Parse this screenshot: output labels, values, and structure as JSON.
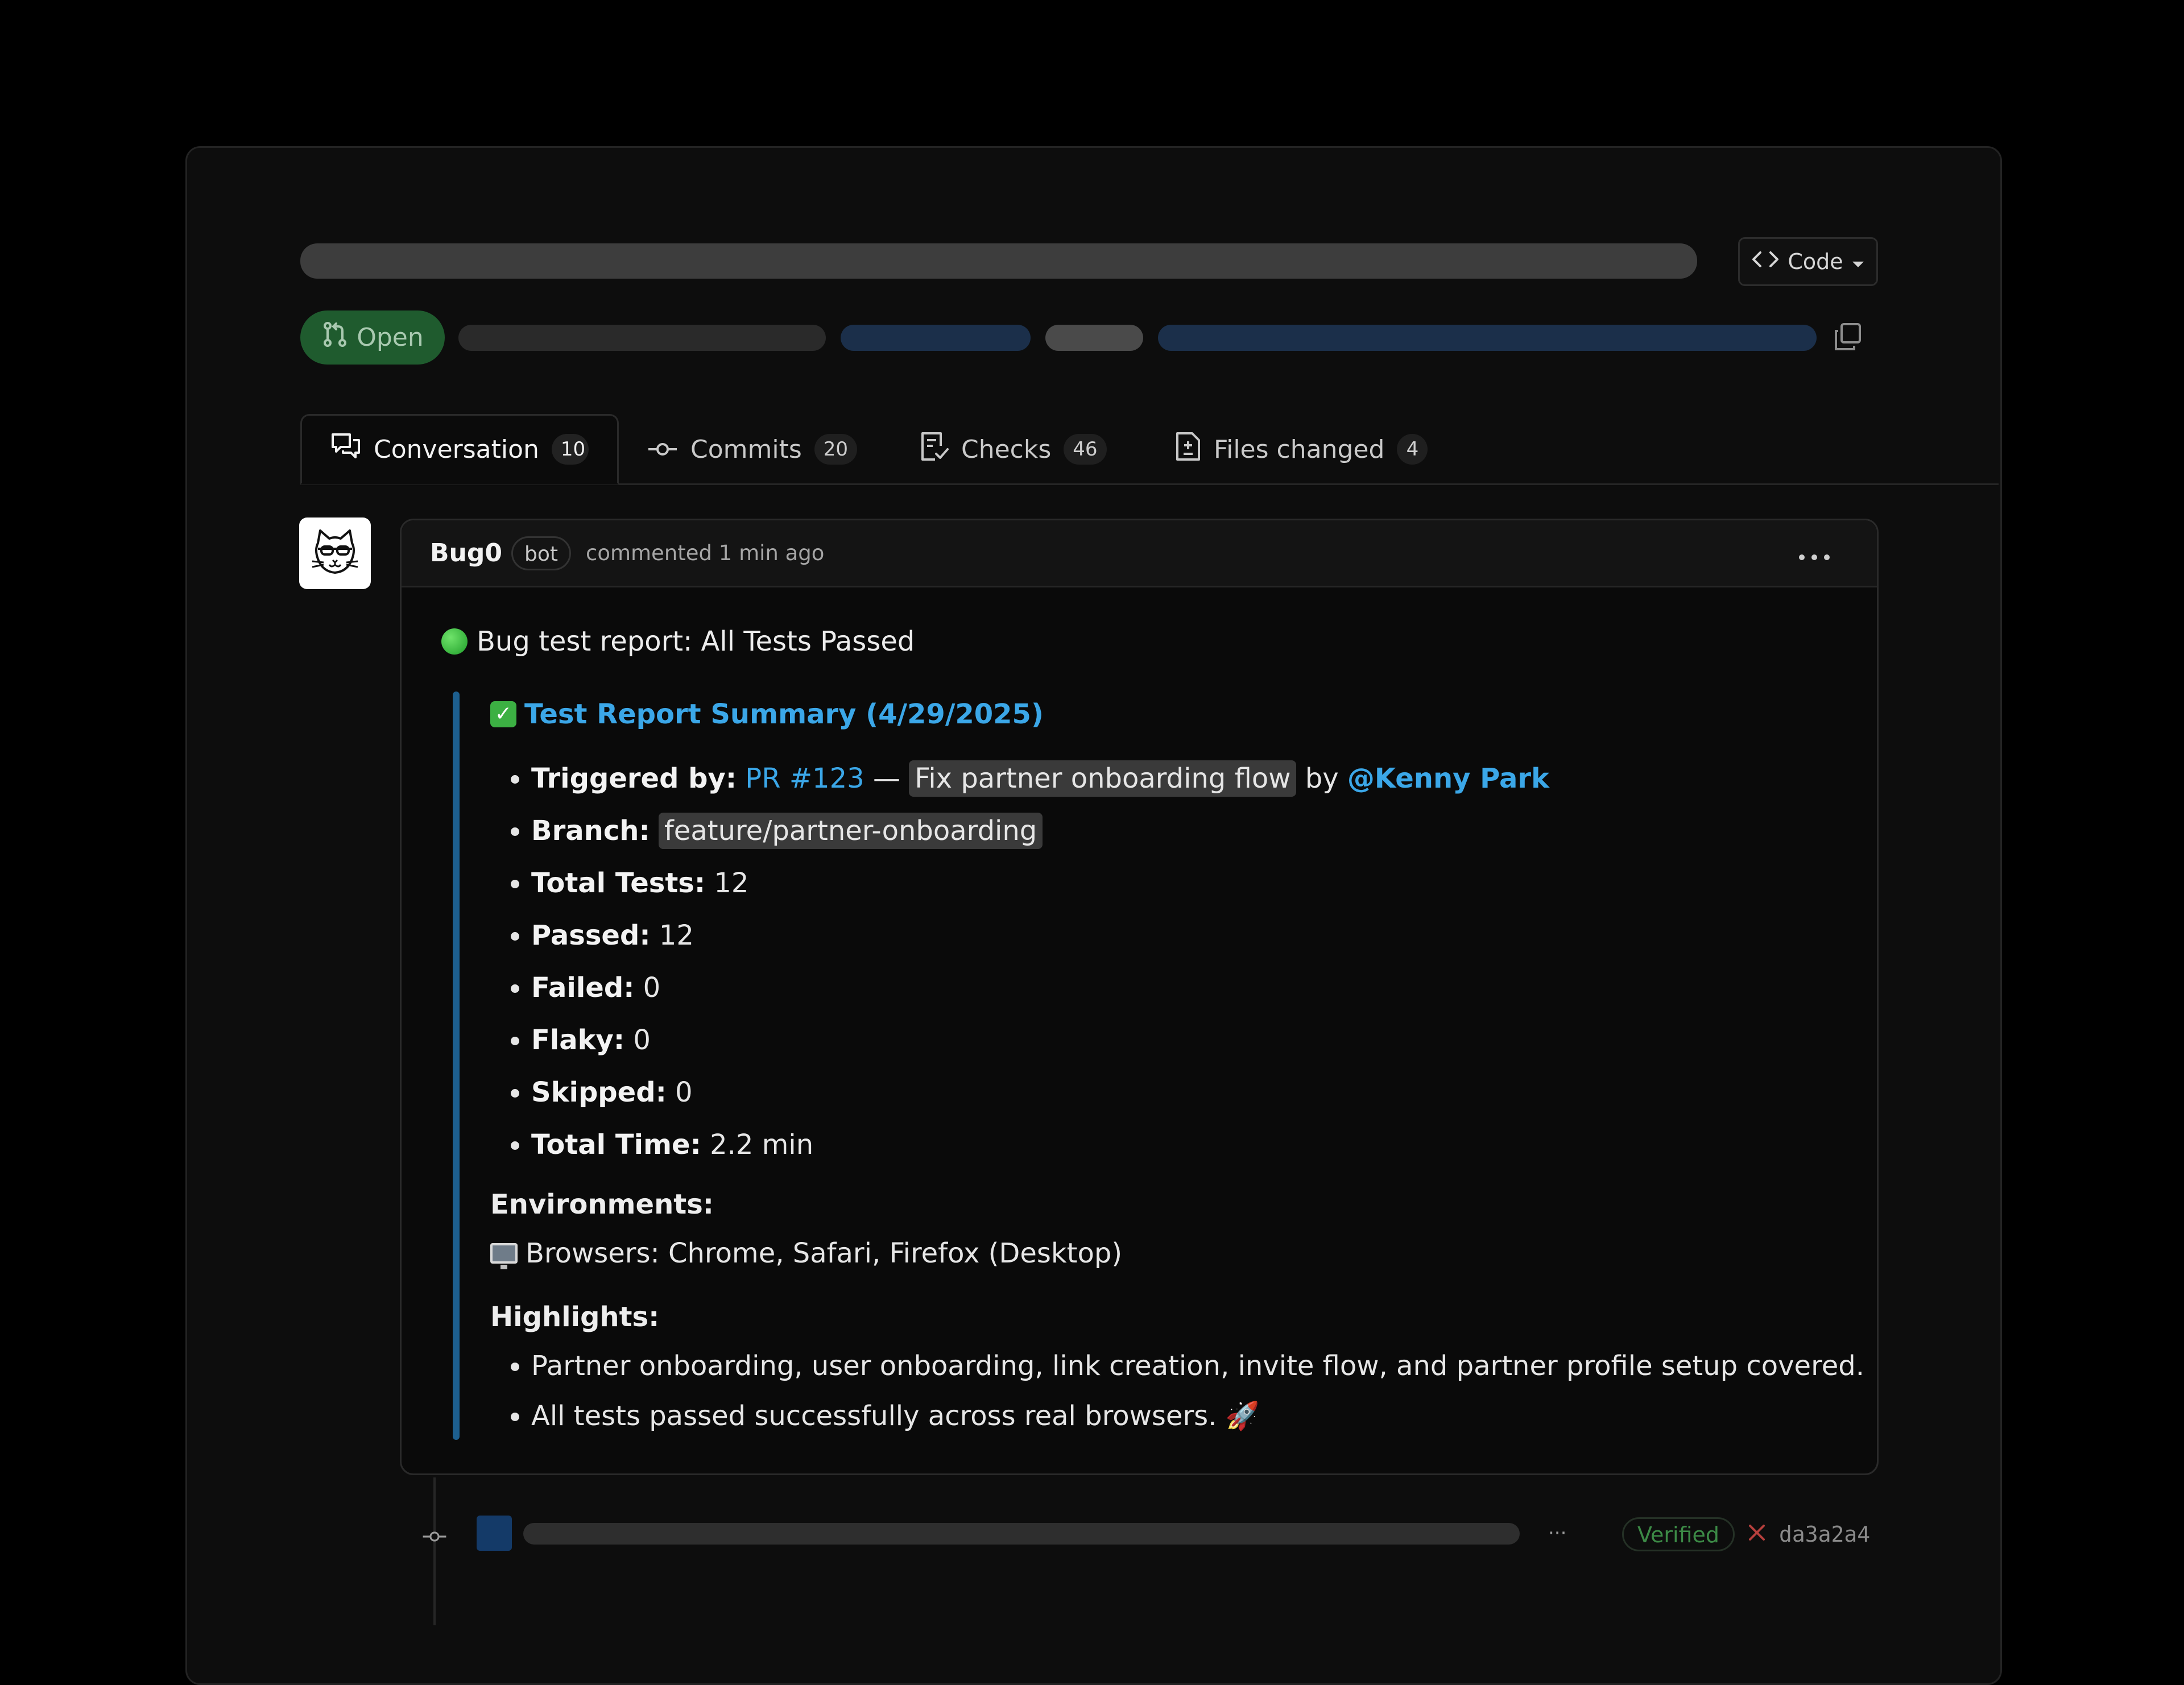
{
  "header": {
    "code_button_label": "Code",
    "status_label": "Open"
  },
  "tabs": [
    {
      "label": "Conversation",
      "count": "10",
      "icon": "comment-discussion-icon"
    },
    {
      "label": "Commits",
      "count": "20",
      "icon": "git-commit-icon"
    },
    {
      "label": "Checks",
      "count": "46",
      "icon": "checklist-icon"
    },
    {
      "label": "Files changed",
      "count": "4",
      "icon": "file-diff-icon"
    }
  ],
  "comment": {
    "author": "Bug0",
    "badge": "bot",
    "meta": "commented 1 min ago",
    "title": "Bug test report: All Tests Passed",
    "summary_heading": "Test Report Summary (4/29/2025)",
    "triggered_label": "Triggered by:",
    "triggered_pr": "PR #123",
    "triggered_dash": "—",
    "triggered_pr_title": "Fix partner onboarding flow",
    "triggered_by": "by",
    "triggered_user": "@Kenny Park",
    "branch_label": "Branch:",
    "branch_value": "feature/partner-onboarding",
    "stats": [
      {
        "label": "Total Tests:",
        "value": "12"
      },
      {
        "label": "Passed:",
        "value": "12"
      },
      {
        "label": "Failed:",
        "value": "0"
      },
      {
        "label": "Flaky:",
        "value": "0"
      },
      {
        "label": "Skipped:",
        "value": "0"
      },
      {
        "label": "Total Time:",
        "value": "2.2 min"
      }
    ],
    "environments_heading": "Environments:",
    "environments_line": "Browsers: Chrome, Safari, Firefox (Desktop)",
    "highlights_heading": "Highlights:",
    "highlights": [
      "Partner onboarding, user onboarding, link creation, invite flow, and partner profile setup covered.",
      "All tests passed successfully across real browsers. 🚀"
    ]
  },
  "commit": {
    "more": "···",
    "verified": "Verified",
    "status_icon": "x-icon",
    "sha": "da3a2a4"
  },
  "colors": {
    "link": "#3ba7e8",
    "open_badge": "#1f5b2e",
    "quote_bar": "#1d5f8f",
    "verified": "#3c8a46",
    "fail": "#b8403d"
  }
}
